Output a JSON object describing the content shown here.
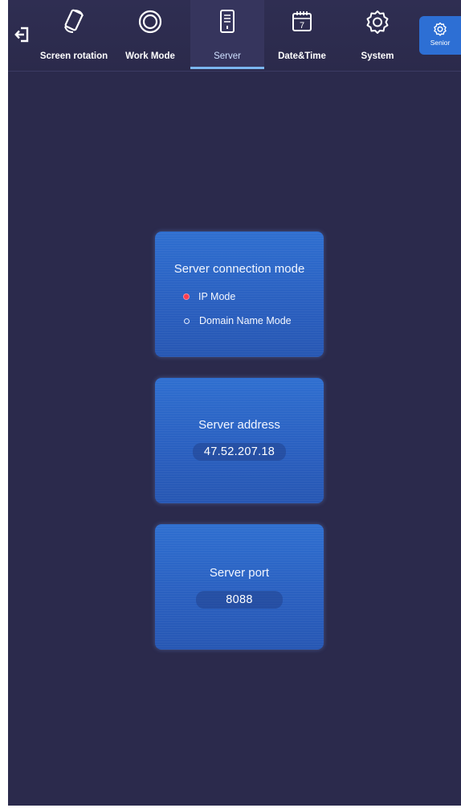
{
  "nav": {
    "tabs": [
      {
        "label": "Screen rotation",
        "icon": "phone-rotate-icon"
      },
      {
        "label": "Work Mode",
        "icon": "work-mode-ring-icon"
      },
      {
        "label": "Server",
        "icon": "server-icon",
        "active": true
      },
      {
        "label": "Date&Time",
        "icon": "calendar-icon"
      },
      {
        "label": "System",
        "icon": "gear-icon"
      }
    ],
    "senior_label": "Senior",
    "active_indicator_color": "#7bb6f0"
  },
  "connection": {
    "title": "Server connection mode",
    "options": [
      {
        "label": "IP Mode",
        "checked": true
      },
      {
        "label": "Domain Name Mode",
        "checked": false
      }
    ]
  },
  "address": {
    "title": "Server address",
    "value": "47.52.207.18"
  },
  "port": {
    "title": "Server port",
    "value": "8088"
  },
  "colors": {
    "background": "#2b2a4c",
    "card": "#2f6fd0",
    "senior_button": "#2d6fd4",
    "radio_checked": "#ff3b4e"
  }
}
